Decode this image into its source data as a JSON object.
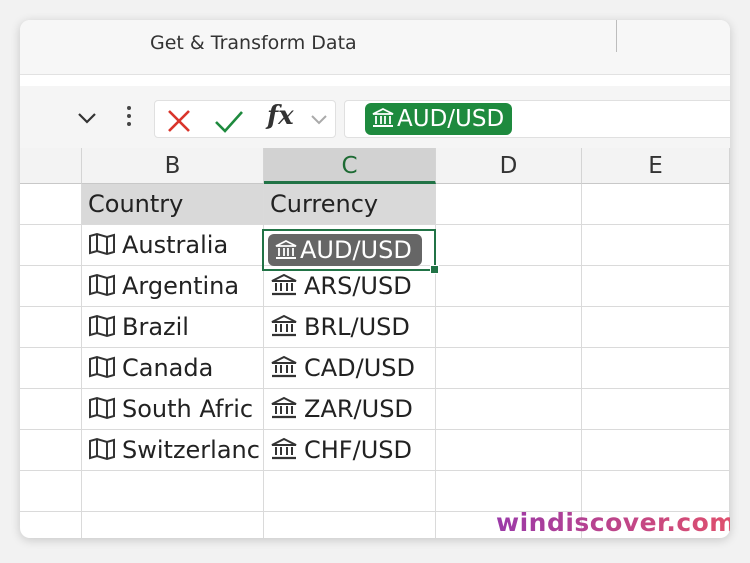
{
  "ribbon": {
    "group_title": "Get & Transform Data"
  },
  "formula_bar": {
    "value": "AUD/USD",
    "fx_label": "fx"
  },
  "columns": [
    "B",
    "C",
    "D",
    "E"
  ],
  "selected_column": "C",
  "table": {
    "headers": [
      "Country",
      "Currency"
    ],
    "rows": [
      {
        "country": "Australia",
        "currency": "AUD/USD"
      },
      {
        "country": "Argentina",
        "currency": "ARS/USD"
      },
      {
        "country": "Brazil",
        "currency": "BRL/USD"
      },
      {
        "country": "Canada",
        "currency": "CAD/USD"
      },
      {
        "country": "South Afric",
        "currency": "ZAR/USD"
      },
      {
        "country": "Switzerlanc",
        "currency": "CHF/USD"
      }
    ]
  },
  "icons": {
    "country": "map-icon",
    "currency": "bank-icon"
  },
  "colors": {
    "accent": "#217346",
    "chip": "#1e8a3e",
    "selected_chip": "#666666"
  },
  "watermark": "windiscover.com"
}
